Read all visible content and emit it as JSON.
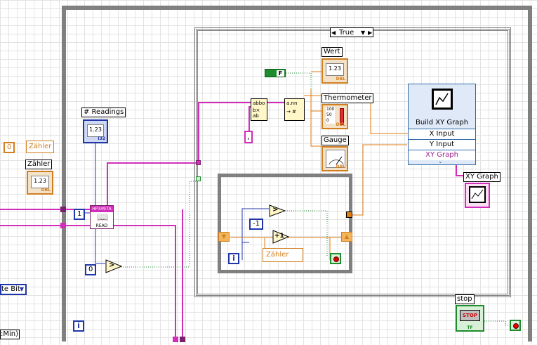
{
  "diagram": {
    "case_selector": "True",
    "labels": {
      "wert": "Wert",
      "thermometer": "Thermometer",
      "gauge": "Gauge",
      "xy_graph": "XY Graph",
      "readings": "# Readings",
      "zaehler": "Zähler",
      "zaehler_const_label": "Zähler",
      "zaehler_inner": "Zähler",
      "stop": "stop",
      "byte_bit": "te Bit",
      "min_label": ":Min)"
    },
    "numeric_display": "1.23",
    "dbl_tag": "DBL",
    "i32_tag": "I32",
    "tf_tag": "TF",
    "tf_const": "F",
    "const_zero_orange": "0",
    "const_one": "1",
    "const_zero_blue": "0",
    "const_neg_one": "-1",
    "comma_const": ",",
    "iteration_label": "i",
    "add_one": "+1",
    "greater": ">",
    "stop_button_text": "STOP",
    "device_name": "HP3497A",
    "device_read": "READ",
    "build_xy": {
      "title": "Build XY Graph",
      "x_input": "X Input",
      "y_input": "Y Input",
      "xy_graph": "XY Graph"
    },
    "thermo_scale": [
      "100",
      "50",
      "0"
    ]
  },
  "colors": {
    "structure": "#808080",
    "wire_pink": "#d12fbb",
    "wire_orange": "#e07e10",
    "wire_blue": "#2036a8",
    "wire_green": "#1c8c2c"
  }
}
